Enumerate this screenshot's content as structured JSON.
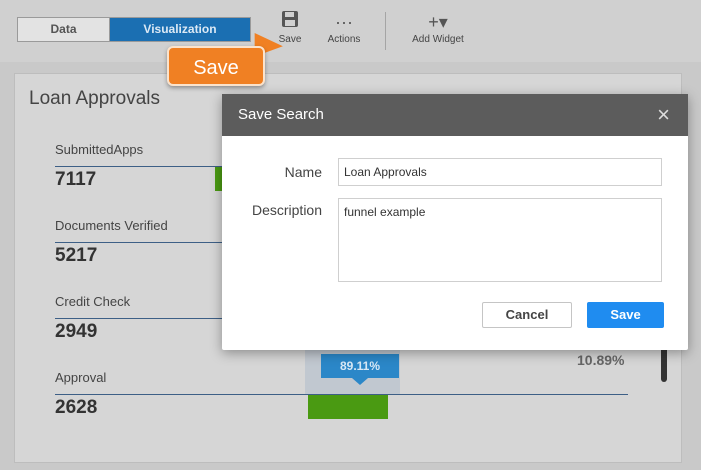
{
  "toolbar": {
    "tab_data": "Data",
    "tab_visualization": "Visualization",
    "save_label": "Save",
    "actions_label": "Actions",
    "add_widget_label": "Add Widget",
    "actions_icon": "···",
    "add_widget_icon": "+▾"
  },
  "callout": {
    "label": "Save",
    "color": "#f08023"
  },
  "panel": {
    "title": "Loan Approvals",
    "metrics": [
      {
        "label": "SubmittedApps",
        "value": "7117"
      },
      {
        "label": "Documents Verified",
        "value": "5217"
      },
      {
        "label": "Credit Check",
        "value": "2949"
      },
      {
        "label": "Approval",
        "value": "2628"
      }
    ],
    "conversion_pct": "89.11%",
    "dropoff_pct": "10.89%"
  },
  "dialog": {
    "title": "Save Search",
    "close_icon": "×",
    "name_label": "Name",
    "name_value": "Loan Approvals",
    "description_label": "Description",
    "description_value": "funnel example",
    "cancel_label": "Cancel",
    "save_label": "Save"
  },
  "colors": {
    "accent": "#1b6fb2",
    "save_button": "#1f8cf0",
    "funnel_bar": "#4a9a12"
  }
}
